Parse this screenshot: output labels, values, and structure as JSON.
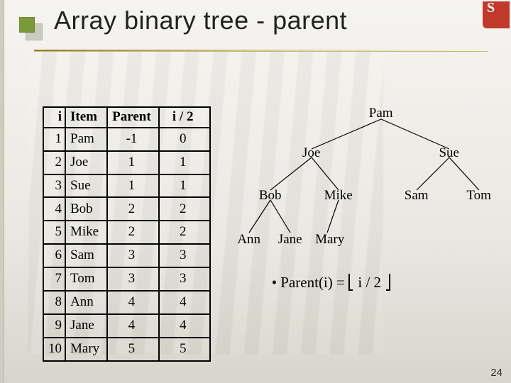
{
  "title": "Array binary tree - parent",
  "page_number": "24",
  "logo_letter": "S",
  "table": {
    "headers": {
      "i": "i",
      "item": "Item",
      "parent": "Parent",
      "idiv2": "i  / 2"
    },
    "rows": [
      {
        "i": "1",
        "item": "Pam",
        "parent": "-1",
        "idiv2": "0"
      },
      {
        "i": "2",
        "item": "Joe",
        "parent": "1",
        "idiv2": "1"
      },
      {
        "i": "3",
        "item": "Sue",
        "parent": "1",
        "idiv2": "1"
      },
      {
        "i": "4",
        "item": "Bob",
        "parent": "2",
        "idiv2": "2"
      },
      {
        "i": "5",
        "item": "Mike",
        "parent": "2",
        "idiv2": "2"
      },
      {
        "i": "6",
        "item": "Sam",
        "parent": "3",
        "idiv2": "3"
      },
      {
        "i": "7",
        "item": "Tom",
        "parent": "3",
        "idiv2": "3"
      },
      {
        "i": "8",
        "item": "Ann",
        "parent": "4",
        "idiv2": "4"
      },
      {
        "i": "9",
        "item": "Jane",
        "parent": "4",
        "idiv2": "4"
      },
      {
        "i": "10",
        "item": "Mary",
        "parent": "5",
        "idiv2": "5"
      }
    ]
  },
  "tree": {
    "nodes": {
      "pam": "Pam",
      "joe": "Joe",
      "sue": "Sue",
      "bob": "Bob",
      "mike": "Mike",
      "sam": "Sam",
      "tom": "Tom",
      "ann": "Ann",
      "jane": "Jane",
      "mary": "Mary"
    }
  },
  "formula": {
    "bullet": "•",
    "lhs": "Parent(i)   =",
    "inner": "i / 2"
  }
}
